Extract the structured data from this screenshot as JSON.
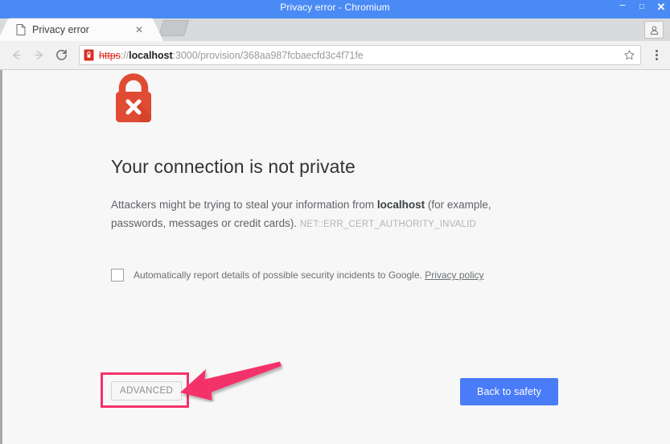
{
  "window": {
    "title": "Privacy error - Chromium",
    "controls": {
      "minimize": "–",
      "maximize": "□",
      "close": "✕"
    }
  },
  "tabs": {
    "active": {
      "title": "Privacy error",
      "favicon_name": "page-icon",
      "close_glyph": "✕"
    },
    "new_tab_name": "new-tab-button"
  },
  "toolbar": {
    "back_name": "back-button",
    "forward_name": "forward-button",
    "reload_name": "reload-button",
    "omnibox": {
      "security_badge": "not-secure-certificate-icon",
      "scheme": "https",
      "separator": "://",
      "host": "localhost",
      "rest": ":3000/provision/368aa987fcbaecfd3c4f71fe",
      "full_url": "https://localhost:3000/provision/368aa987fcbaecfd3c4f71fe"
    },
    "star_name": "bookmark-star-icon",
    "menu_name": "chrome-menu-button",
    "profile_name": "profile-avatar-button"
  },
  "interstitial": {
    "icon_name": "lock-with-x-icon",
    "heading": "Your connection is not private",
    "body_part1": "Attackers might be trying to steal your information from ",
    "body_host": "localhost",
    "body_part2": " (for example, passwords, messages or credit cards). ",
    "error_code": "NET::ERR_CERT_AUTHORITY_INVALID",
    "checkbox_checked": false,
    "checkbox_label": "Automatically report details of possible security incidents to Google. ",
    "privacy_link": "Privacy policy",
    "advanced_label": "ADVANCED",
    "back_to_safety_label": "Back to safety"
  },
  "annotation": {
    "highlight_target": "advanced-button",
    "arrow_name": "pink-pointer-arrow",
    "color": "#f4336b"
  },
  "colors": {
    "title_bar": "#4a8af4",
    "tab_strip": "#d9dadb",
    "toolbar": "#f1f1f1",
    "page_background": "#f7f7f7",
    "lock_red": "#e04b33",
    "primary_button": "#4a7cf7",
    "annotation_pink": "#f4336b",
    "error_text": "#d93025"
  }
}
